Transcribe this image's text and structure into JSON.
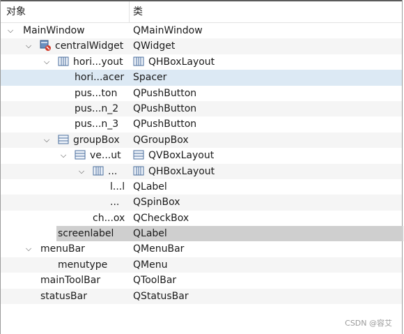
{
  "header": {
    "col_object": "对象",
    "col_class": "类"
  },
  "rows": [
    {
      "name": "MainWindow",
      "type": "QMainWindow"
    },
    {
      "name": "centralWidget",
      "type": "QWidget"
    },
    {
      "name": "hori...yout",
      "type": "QHBoxLayout"
    },
    {
      "name": "hori...acer",
      "type": "Spacer"
    },
    {
      "name": "pus...ton",
      "type": "QPushButton"
    },
    {
      "name": "pus...n_2",
      "type": "QPushButton"
    },
    {
      "name": "pus...n_3",
      "type": "QPushButton"
    },
    {
      "name": "groupBox",
      "type": "QGroupBox"
    },
    {
      "name": "ve...ut",
      "type": "QVBoxLayout"
    },
    {
      "name": "...",
      "type": "QHBoxLayout"
    },
    {
      "name": "l...l",
      "type": "QLabel"
    },
    {
      "name": "...",
      "type": "QSpinBox"
    },
    {
      "name": "ch...ox",
      "type": "QCheckBox"
    },
    {
      "name": "screenlabel",
      "type": "QLabel"
    },
    {
      "name": "menuBar",
      "type": "QMenuBar"
    },
    {
      "name": "menutype",
      "type": "QMenu"
    },
    {
      "name": "mainToolBar",
      "type": "QToolBar"
    },
    {
      "name": "statusBar",
      "type": "QStatusBar"
    }
  ],
  "watermark": "CSDN @容艾",
  "colors": {
    "selected": "#dce9f4",
    "highlight": "#cfcfcf",
    "alt_row": "#f5f5f5"
  }
}
